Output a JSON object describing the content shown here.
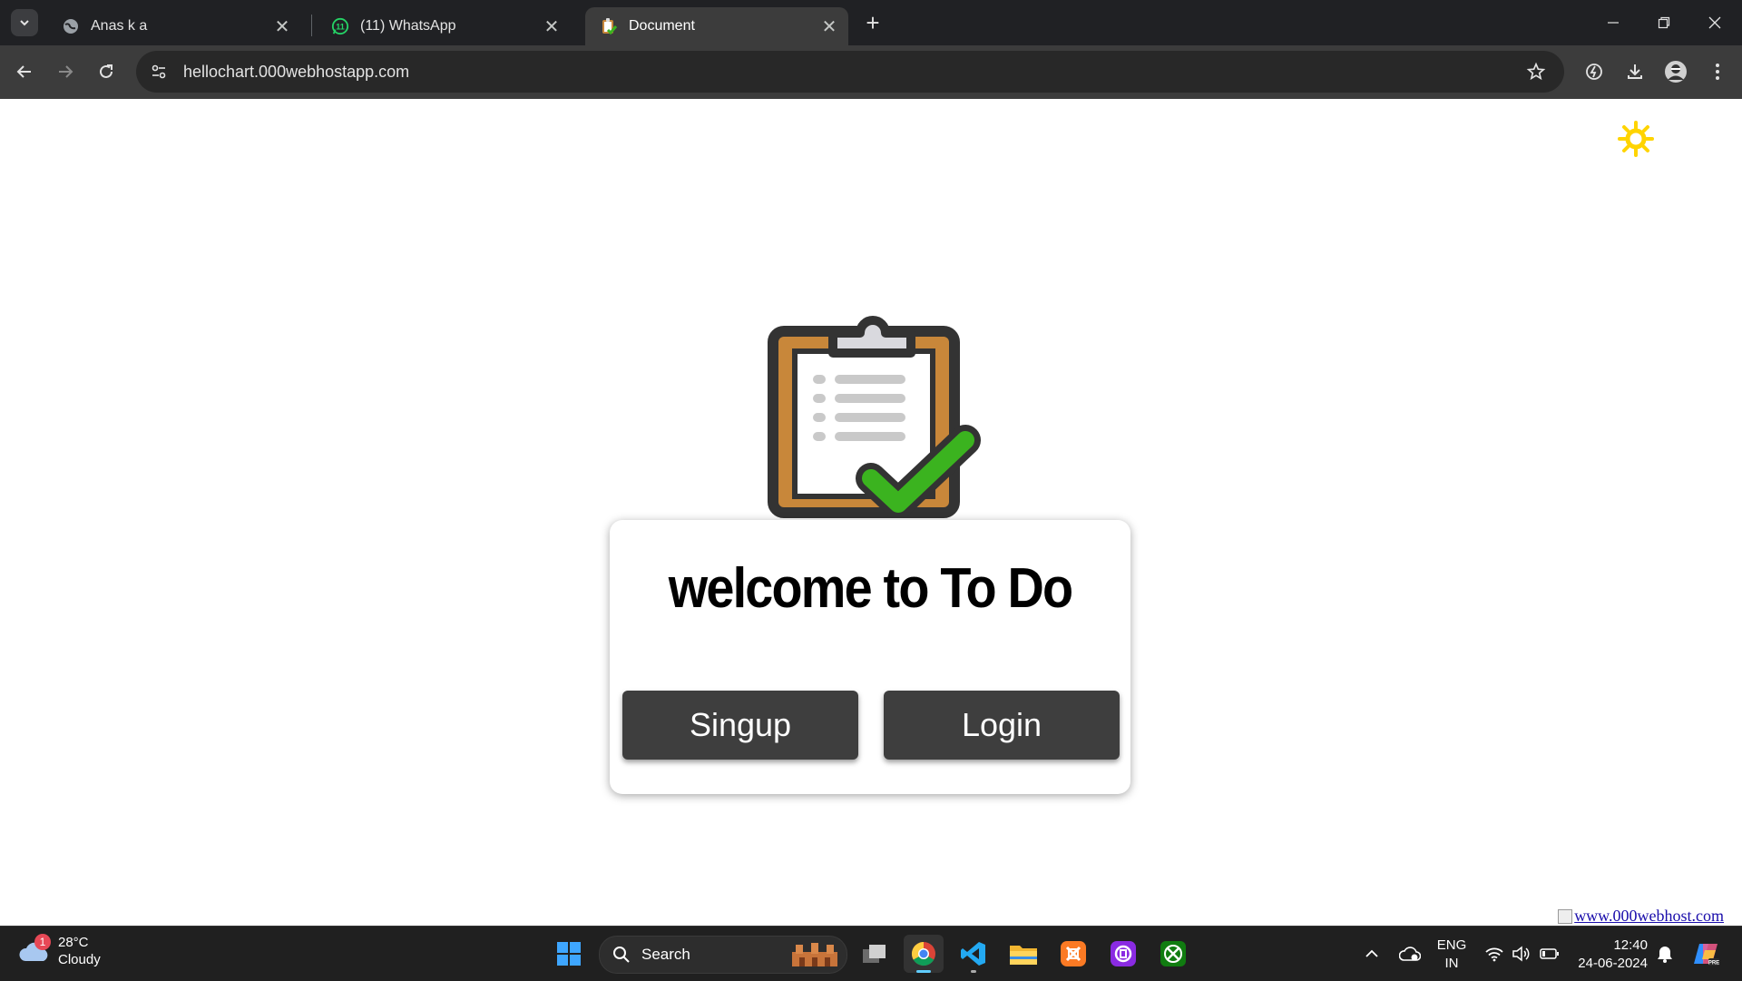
{
  "browser": {
    "tabs": [
      {
        "title": "Anas k a",
        "active": false
      },
      {
        "title": "(11) WhatsApp",
        "active": false,
        "badge": "11"
      },
      {
        "title": "Document",
        "active": true
      }
    ],
    "url": "hellochart.000webhostapp.com"
  },
  "page": {
    "title": "welcome to To Do",
    "signup_label": "Singup",
    "login_label": "Login",
    "host_badge": "www.000webhost.com"
  },
  "taskbar": {
    "weather": {
      "temp": "28°C",
      "condition": "Cloudy",
      "badge": "1"
    },
    "search_label": "Search",
    "language": {
      "line1": "ENG",
      "line2": "IN"
    },
    "clock": {
      "time": "12:40",
      "date": "24-06-2024"
    }
  },
  "colors": {
    "tabstrip": "#202124",
    "toolbar": "#3c3c3c",
    "button": "#3e3e3e",
    "sun": "#ffd400",
    "check": "#3bb31f"
  }
}
